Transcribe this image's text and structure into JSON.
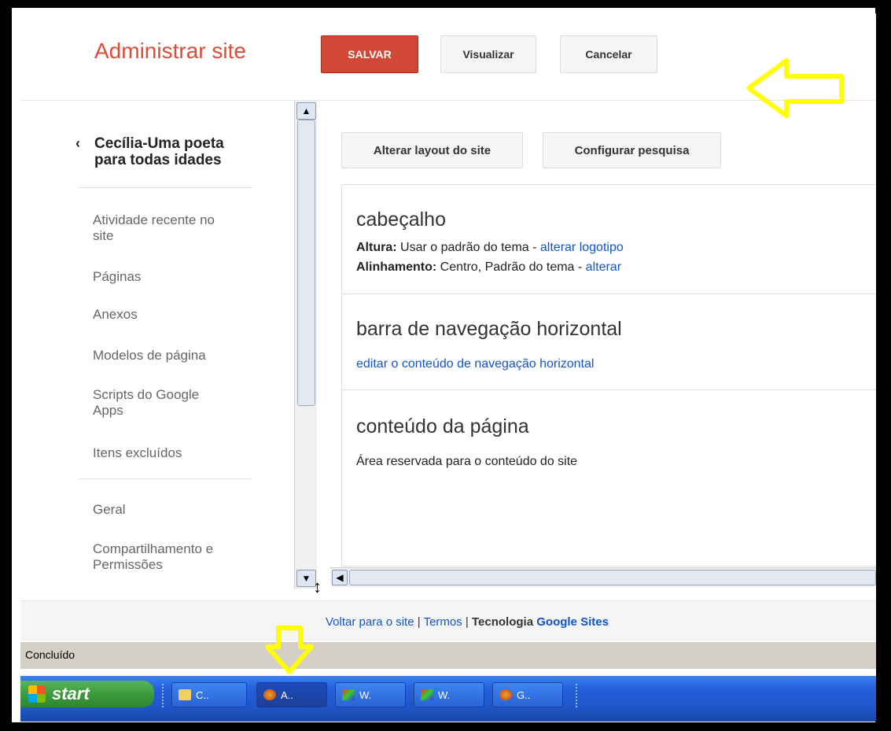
{
  "header": {
    "title": "Administrar site",
    "save_label": "SALVAR",
    "preview_label": "Visualizar",
    "cancel_label": "Cancelar"
  },
  "sidebar": {
    "site_name_line1": "Cecília-Uma poeta",
    "site_name_line2": "para todas idades",
    "items": [
      {
        "line1": "Atividade recente no",
        "line2": "site"
      },
      {
        "line1": "Páginas"
      },
      {
        "line1": "Anexos"
      },
      {
        "line1": "Modelos de página"
      },
      {
        "line1": "Scripts do Google",
        "line2": "Apps"
      },
      {
        "line1": "Itens excluídos"
      },
      {
        "line1": "Geral"
      },
      {
        "line1": "Compartilhamento e",
        "line2": "Permissões"
      }
    ]
  },
  "main": {
    "layout_button": "Alterar layout do site",
    "search_button": "Configurar pesquisa",
    "header_section": {
      "title": "cabeçalho",
      "height_label": "Altura:",
      "height_value": "Usar o padrão do tema -",
      "height_link": "alterar logotipo",
      "align_label": "Alinhamento:",
      "align_value": "Centro, Padrão do tema -",
      "align_link": "alterar"
    },
    "nav_section": {
      "title": "barra de navegação horizontal",
      "link": "editar o conteúdo de navegação horizontal"
    },
    "content_section": {
      "title": "conteúdo da página",
      "text": "Área reservada para o conteúdo do site"
    }
  },
  "footer": {
    "back_link": "Voltar para o site",
    "terms_link": "Termos",
    "powered_prefix": "Tecnologia",
    "powered_brand": "Google Sites",
    "sep": "|"
  },
  "statusbar": {
    "text": "Concluído"
  },
  "taskbar": {
    "start_label": "start",
    "tasks": [
      {
        "label": "C..",
        "icon": "folder-icon"
      },
      {
        "label": "A..",
        "icon": "firefox-icon"
      },
      {
        "label": "W.",
        "icon": "paint-icon"
      },
      {
        "label": "W.",
        "icon": "paint-icon"
      },
      {
        "label": "G..",
        "icon": "firefox-icon"
      }
    ]
  },
  "colors": {
    "accent_red": "#dd4b39",
    "save_button": "#d14836",
    "link_blue": "#1155cc",
    "annotation_yellow": "#ffff00"
  }
}
